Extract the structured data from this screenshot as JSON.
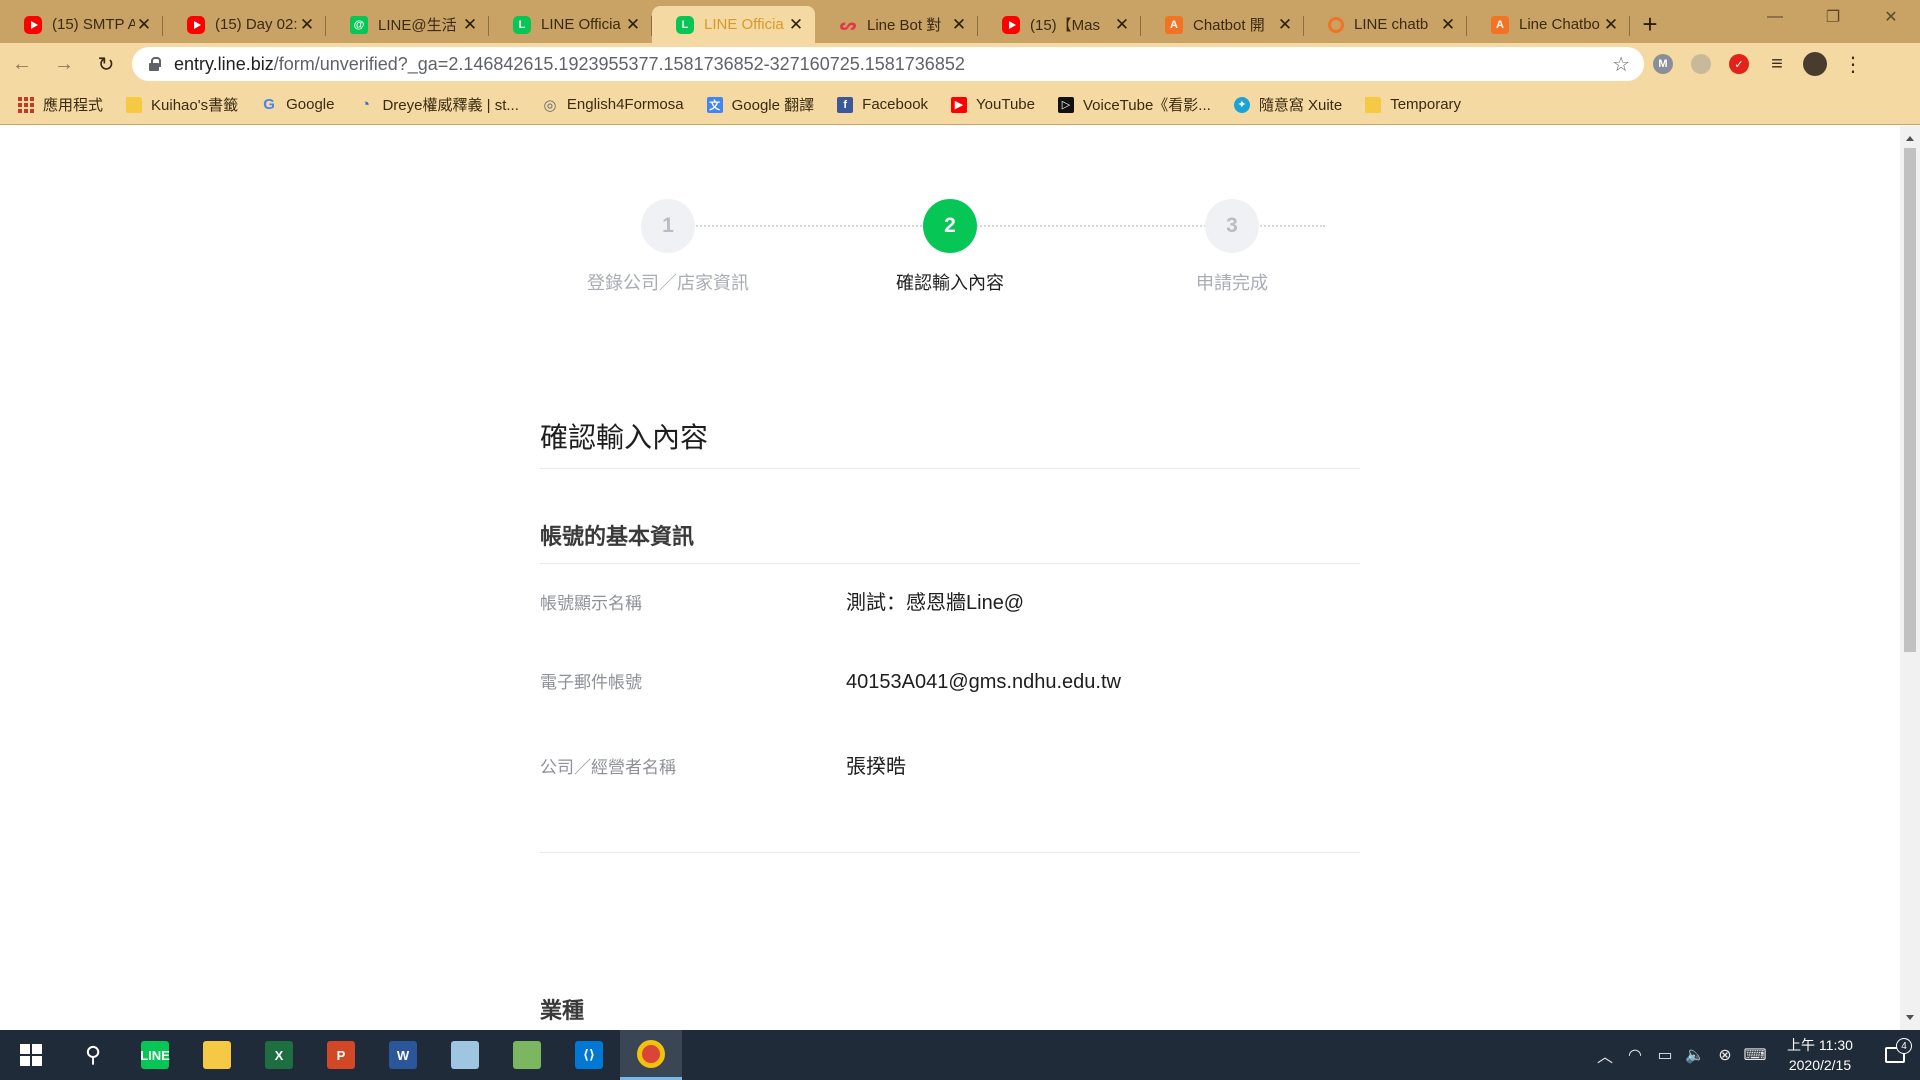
{
  "browser": {
    "tabs": [
      {
        "favicon": "youtube-icon",
        "title": "(15) SMTP A"
      },
      {
        "favicon": "youtube-icon",
        "title": "(15) Day 02:"
      },
      {
        "favicon": "line-at-icon",
        "title": "LINE@生活"
      },
      {
        "favicon": "line-icon",
        "title": "LINE Officia"
      },
      {
        "favicon": "line-icon",
        "title": "LINE Officia",
        "active": true
      },
      {
        "favicon": "red-logo-icon",
        "title": "Line Bot 對"
      },
      {
        "favicon": "youtube-icon",
        "title": "(15)【Mas"
      },
      {
        "favicon": "orange-a-icon",
        "title": "Chatbot 開"
      },
      {
        "favicon": "orange-circle-icon",
        "title": "LINE chatb"
      },
      {
        "favicon": "orange-a-icon",
        "title": "Line Chatbo"
      }
    ],
    "new_tab_label": "+",
    "url_host": "entry.line.biz",
    "url_path": "/form/unverified?_ga=2.146842615.1923955377.1581736852-327160725.1581736852",
    "bookmarks": [
      {
        "icon": "apps-grid-icon",
        "label": "應用程式"
      },
      {
        "icon": "folder-icon",
        "label": "Kuihao's書籤"
      },
      {
        "icon": "google-icon",
        "label": "Google"
      },
      {
        "icon": "dreye-icon",
        "label": "Dreye權威釋義 | st..."
      },
      {
        "icon": "globe-icon",
        "label": "English4Formosa"
      },
      {
        "icon": "google-translate-icon",
        "label": "Google 翻譯"
      },
      {
        "icon": "facebook-icon",
        "label": "Facebook"
      },
      {
        "icon": "youtube-icon",
        "label": "YouTube"
      },
      {
        "icon": "voicetube-icon",
        "label": "VoiceTube《看影..."
      },
      {
        "icon": "xuite-icon",
        "label": "隨意窩 Xuite"
      },
      {
        "icon": "folder-icon",
        "label": "Temporary"
      }
    ],
    "extensions": [
      "m-extension-icon",
      "cloud-extension-icon",
      "trend-micro-icon",
      "media-icon",
      "profile-avatar"
    ]
  },
  "stepper": {
    "steps": [
      {
        "number": "1",
        "label": "登錄公司／店家資訊"
      },
      {
        "number": "2",
        "label": "確認輸入內容"
      },
      {
        "number": "3",
        "label": "申請完成"
      }
    ],
    "active_step": 2
  },
  "page": {
    "heading": "確認輸入內容",
    "section_basic": "帳號的基本資訊",
    "fields": [
      {
        "label": "帳號顯示名稱",
        "value": "測試：感恩牆Line@"
      },
      {
        "label": "電子郵件帳號",
        "value": "40153A041@gms.ndhu.edu.tw"
      },
      {
        "label": "公司／經營者名稱",
        "value": "張揆晧"
      }
    ],
    "section_industry": "業種"
  },
  "taskbar": {
    "apps": [
      "windows-start-icon",
      "search-icon",
      "line-app-icon",
      "file-explorer-icon",
      "excel-icon",
      "powerpoint-icon",
      "word-icon",
      "notepad-icon",
      "photos-icon",
      "vscode-icon",
      "chrome-icon"
    ],
    "clock_time": "上午 11:30",
    "clock_date": "2020/2/15",
    "notification_count": "4"
  },
  "colors": {
    "tab_strip": "#c9a365",
    "toolbar": "#f4d9a2",
    "line_green": "#06c755",
    "taskbar": "#1f2b38"
  }
}
